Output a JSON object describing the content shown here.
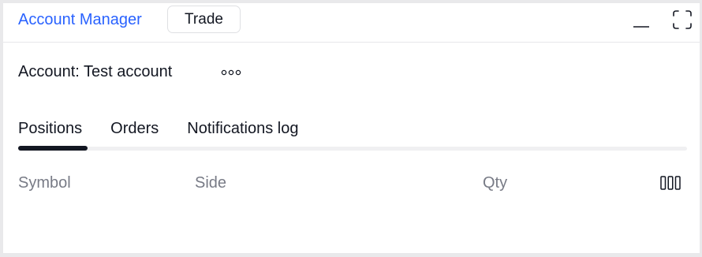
{
  "header": {
    "active_tab_label": "Account Manager",
    "trade_button_label": "Trade",
    "minimize_icon": "minimize-icon",
    "maximize_icon": "maximize-icon"
  },
  "account": {
    "label": "Account: Test account",
    "more_icon": "more-horizontal-icon"
  },
  "tabs": [
    {
      "label": "Positions",
      "active": true
    },
    {
      "label": "Orders",
      "active": false
    },
    {
      "label": "Notifications log",
      "active": false
    }
  ],
  "table": {
    "columns": [
      "Symbol",
      "Side",
      "Qty"
    ],
    "columns_settings_icon": "columns-icon",
    "rows": []
  },
  "colors": {
    "accent": "#2962ff",
    "text": "#131722",
    "muted": "#787b86"
  }
}
